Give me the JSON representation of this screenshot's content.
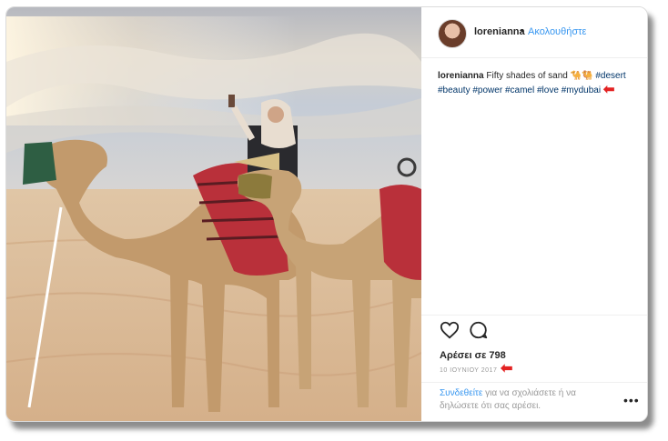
{
  "post": {
    "username": "lorenianna",
    "separator": "•",
    "follow_label": "Ακολουθήστε",
    "caption_user": "lorenianna",
    "caption_text": "Fifty shades of sand",
    "caption_emoji": "🐪🐫",
    "hashtags_line1": [
      "#desert"
    ],
    "hashtags_line2": [
      "#beauty",
      "#power",
      "#camel",
      "#love",
      "#mydubai"
    ],
    "likes_label": "Αρέσει σε 798",
    "date": "10 ΙΟΥΝΙΟΥ 2017",
    "login_link": "Συνδεθείτε",
    "login_text": " για να σχολιάσετε ή να δηλώσετε ότι σας αρέσει.",
    "more_label": "•••",
    "annotation_arrow": "⬅"
  },
  "icons": {
    "like": "heart-outline-icon",
    "comment": "comment-bubble-icon",
    "more": "more-options-icon"
  },
  "colors": {
    "link": "#3897f0",
    "hashtag": "#003569",
    "annotation": "#e32222",
    "text": "#262626",
    "muted": "#999999"
  }
}
